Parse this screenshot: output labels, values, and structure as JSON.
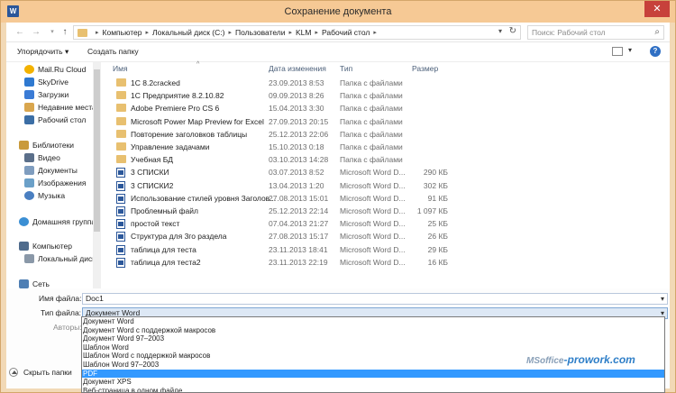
{
  "window": {
    "title": "Сохранение документа",
    "app_icon": "W",
    "close_glyph": "✕"
  },
  "address": {
    "crumbs": [
      "Компьютер",
      "Локальный диск (C:)",
      "Пользователи",
      "KLM",
      "Рабочий стол"
    ],
    "search_placeholder": "Поиск: Рабочий стол"
  },
  "toolbar": {
    "organize_label": "Упорядочить ▾",
    "new_folder_label": "Создать папку"
  },
  "sidebar": {
    "favorites": [
      "Mail.Ru Cloud",
      "SkyDrive",
      "Загрузки",
      "Недавние места",
      "Рабочий стол"
    ],
    "libraries_label": "Библиотеки",
    "libraries": [
      "Видео",
      "Документы",
      "Изображения",
      "Музыка"
    ],
    "homegroup_label": "Домашняя группа",
    "computer_label": "Компьютер",
    "computer_items": [
      "Локальный диск"
    ],
    "network_label": "Сеть"
  },
  "columns": {
    "name": "Имя",
    "date": "Дата изменения",
    "type": "Тип",
    "size": "Размер"
  },
  "files": [
    {
      "name": "1С 8.2cracked",
      "date": "23.09.2013 8:53",
      "type": "Папка с файлами",
      "size": "",
      "kind": "folder"
    },
    {
      "name": "1С Предприятие 8.2.10.82",
      "date": "09.09.2013 8:26",
      "type": "Папка с файлами",
      "size": "",
      "kind": "folder"
    },
    {
      "name": "Adobe Premiere Pro CS 6",
      "date": "15.04.2013 3:30",
      "type": "Папка с файлами",
      "size": "",
      "kind": "folder"
    },
    {
      "name": "Microsoft Power Map Preview for Excel",
      "date": "27.09.2013 20:15",
      "type": "Папка с файлами",
      "size": "",
      "kind": "folder"
    },
    {
      "name": "Повторение заголовков таблицы",
      "date": "25.12.2013 22:06",
      "type": "Папка с файлами",
      "size": "",
      "kind": "folder"
    },
    {
      "name": "Управление задачами",
      "date": "15.10.2013 0:18",
      "type": "Папка с файлами",
      "size": "",
      "kind": "folder"
    },
    {
      "name": "Учебная БД",
      "date": "03.10.2013 14:28",
      "type": "Папка с файлами",
      "size": "",
      "kind": "folder"
    },
    {
      "name": "3 СПИСКИ",
      "date": "03.07.2013 8:52",
      "type": "Microsoft Word D...",
      "size": "290 КБ",
      "kind": "doc"
    },
    {
      "name": "3 СПИСКИ2",
      "date": "13.04.2013 1:20",
      "type": "Microsoft Word D...",
      "size": "302 КБ",
      "kind": "doc"
    },
    {
      "name": "Использование стилей уровня Заголов...",
      "date": "27.08.2013 15:01",
      "type": "Microsoft Word D...",
      "size": "91 КБ",
      "kind": "doc"
    },
    {
      "name": "Проблемный файл",
      "date": "25.12.2013 22:14",
      "type": "Microsoft Word D...",
      "size": "1 097 КБ",
      "kind": "doc"
    },
    {
      "name": "простой текст",
      "date": "07.04.2013 21:27",
      "type": "Microsoft Word D...",
      "size": "25 КБ",
      "kind": "doc"
    },
    {
      "name": "Структура для 3го раздела",
      "date": "27.08.2013 15:17",
      "type": "Microsoft Word D...",
      "size": "26 КБ",
      "kind": "doc"
    },
    {
      "name": "таблица для теста",
      "date": "23.11.2013 18:41",
      "type": "Microsoft Word D...",
      "size": "29 КБ",
      "kind": "doc"
    },
    {
      "name": "таблица для теста2",
      "date": "23.11.2013 22:19",
      "type": "Microsoft Word D...",
      "size": "16 КБ",
      "kind": "doc"
    }
  ],
  "form": {
    "filename_label": "Имя файла:",
    "filename_value": "Doc1",
    "filetype_label": "Тип файла:",
    "filetype_value": "Документ Word",
    "authors_label": "Авторы:"
  },
  "filetype_options": [
    "Документ Word",
    "Документ Word с поддержкой макросов",
    "Документ Word 97–2003",
    "Шаблон Word",
    "Шаблон Word с поддержкой макросов",
    "Шаблон Word 97–2003",
    "PDF",
    "Документ XPS",
    "Веб-страница в одном файле"
  ],
  "highlighted_option": "PDF",
  "hide_folders_label": "Скрыть папки",
  "watermark": {
    "prefix": "MSoffice",
    "suffix": "-prowork.com"
  },
  "colors": {
    "titlebar": "#f6c995",
    "selection": "#3399ff",
    "word_blue": "#2b579a"
  }
}
